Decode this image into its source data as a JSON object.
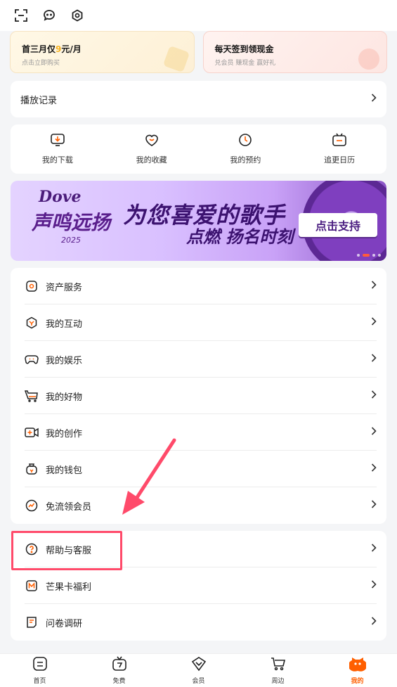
{
  "colors": {
    "accent": "#ff5f00",
    "highlight": "#ff4a6a"
  },
  "topbar": {
    "icons": [
      "scan-icon",
      "message-icon",
      "settings-icon"
    ]
  },
  "promos": [
    {
      "title": "首三月仅",
      "price": "9",
      "unit": "元/月",
      "sub": "点击立即购买"
    },
    {
      "title": "每天签到领现金",
      "sub": "兑会员 赚现金 赢好礼"
    }
  ],
  "history": {
    "label": "播放记录"
  },
  "shortcuts": [
    {
      "label": "我的下载",
      "icon": "download-icon"
    },
    {
      "label": "我的收藏",
      "icon": "favorite-icon"
    },
    {
      "label": "我的预约",
      "icon": "clock-icon"
    },
    {
      "label": "追更日历",
      "icon": "calendar-icon"
    }
  ],
  "banner": {
    "brand": "Dove",
    "brand_sub": "声鸣远扬",
    "year": "2025",
    "slogan1": "为您喜爱的歌手",
    "slogan2": "点燃 扬名时刻",
    "button": "点击支持"
  },
  "menu": [
    {
      "label": "资产服务",
      "icon": "asset-icon"
    },
    {
      "label": "我的互动",
      "icon": "interaction-icon"
    },
    {
      "label": "我的娱乐",
      "icon": "game-icon"
    },
    {
      "label": "我的好物",
      "icon": "shopping-cart-icon"
    },
    {
      "label": "我的创作",
      "icon": "video-camera-icon"
    },
    {
      "label": "我的钱包",
      "icon": "wallet-icon"
    },
    {
      "label": "免流领会员",
      "icon": "free-data-icon"
    }
  ],
  "menu2": [
    {
      "label": "帮助与客服",
      "icon": "help-icon"
    },
    {
      "label": "芒果卡福利",
      "icon": "mango-card-icon"
    },
    {
      "label": "问卷调研",
      "icon": "survey-icon"
    }
  ],
  "nav": [
    {
      "label": "首页",
      "icon": "home-icon"
    },
    {
      "label": "免费",
      "icon": "free-tv-icon"
    },
    {
      "label": "会员",
      "icon": "vip-icon"
    },
    {
      "label": "周边",
      "icon": "cart-icon"
    },
    {
      "label": "我的",
      "icon": "profile-icon",
      "active": true
    }
  ]
}
